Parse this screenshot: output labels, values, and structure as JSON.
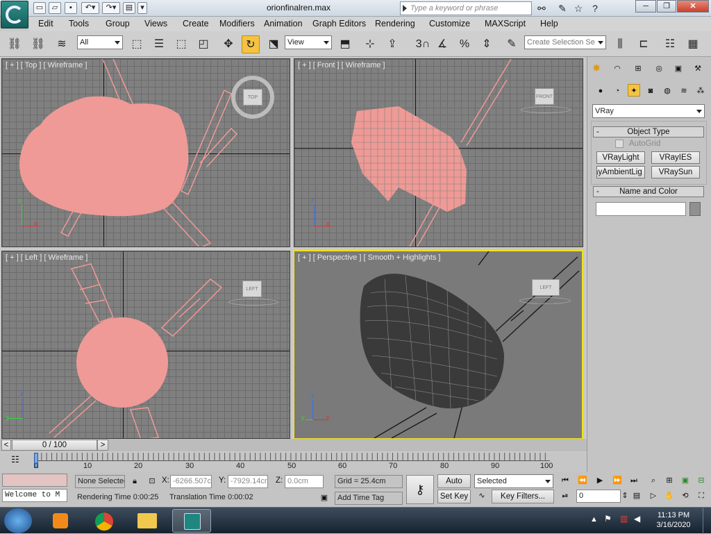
{
  "title": {
    "filename": "orionfinalren.max",
    "search_placeholder": "Type a keyword or phrase"
  },
  "menu": [
    "Edit",
    "Tools",
    "Group",
    "Views",
    "Create",
    "Modifiers",
    "Animation",
    "Graph Editors",
    "Rendering",
    "Customize",
    "MAXScript",
    "Help"
  ],
  "toolbar": {
    "filter": "All",
    "ref_coord": "View",
    "selection_set": "Create Selection Se",
    "snap_value": "3"
  },
  "viewports": {
    "top": {
      "label": "[ + ] [ Top ] [ Wireframe ]",
      "cube": "TOP"
    },
    "front": {
      "label": "[ + ] [ Front ] [ Wireframe ]",
      "cube": "FRONT"
    },
    "left": {
      "label": "[ + ] [ Left ] [ Wireframe ]",
      "cube": "LEFT"
    },
    "perspective": {
      "label": "[ + ] [ Perspective ] [ Smooth + Highlights ]",
      "cube": "LEFT FRONT"
    }
  },
  "gizmo": {
    "x": "x",
    "y": "y",
    "z": "z"
  },
  "timeslider": {
    "label": "0 / 100"
  },
  "trackbar": {
    "ticks": [
      "0",
      "10",
      "20",
      "30",
      "40",
      "50",
      "60",
      "70",
      "80",
      "90",
      "100"
    ]
  },
  "cmdpanel": {
    "renderer": "VRay",
    "object_type": "Object Type",
    "autogrid": "AutoGrid",
    "buttons": [
      "VRayLight",
      "VRayIES",
      "rayAmbientLig",
      "VRaySun"
    ],
    "name_color": "Name and Color",
    "name_value": "",
    "color": "#909090"
  },
  "status": {
    "selection": "None Selected",
    "maxscript": "Welcome to M",
    "x_label": "X:",
    "x_value": "-6266.507c",
    "y_label": "Y:",
    "y_value": "-7929.14cr",
    "z_label": "Z:",
    "z_value": "0.0cm",
    "grid": "Grid = 25.4cm",
    "rendering_time": "Rendering Time  0:00:25",
    "translation_time": "Translation Time  0:00:02",
    "add_time_tag": "Add Time Tag",
    "auto_key": "Auto Key",
    "set_key": "Set Key",
    "key_mode": "Selected",
    "key_filters": "Key Filters...",
    "frame": "0"
  },
  "taskbar": {
    "time": "11:13 PM",
    "date": "3/16/2020"
  },
  "colors": {
    "wire": "#ef9a96",
    "active_border": "#f0e11a"
  }
}
